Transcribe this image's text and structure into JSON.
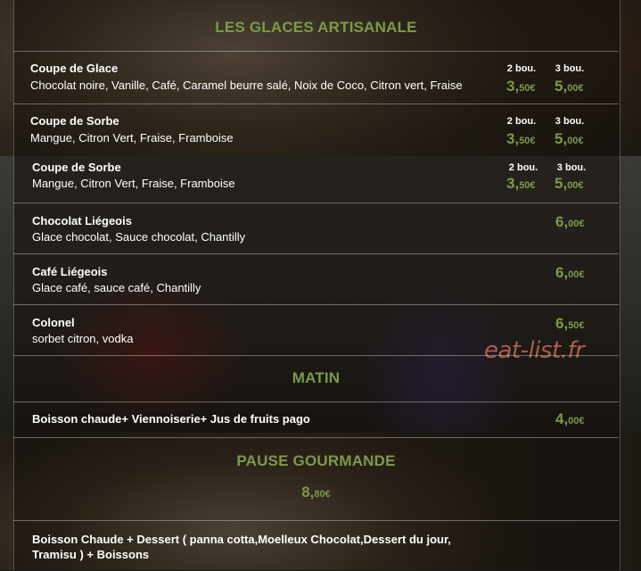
{
  "sections": {
    "glaces_title": "LES GLACES ARTISANALE",
    "matin_title": "MATIN",
    "pause_title": "PAUSE GOURMANDE"
  },
  "size_labels": {
    "two": "2 bou.",
    "three": "3 bou."
  },
  "glaces": [
    {
      "name": "Coupe de Glace",
      "desc": "Chocolat noire, Vanille, Café, Caramel beurre salé, Noix de Coco, Citron vert, Fraise",
      "price2_int": "3,",
      "price2_dec": "50€",
      "price3_int": "5,",
      "price3_dec": "00€"
    },
    {
      "name": "Coupe de Sorbe",
      "desc": "Mangue, Citron Vert, Fraise, Framboise",
      "price2_int": "3,",
      "price2_dec": "50€",
      "price3_int": "5,",
      "price3_dec": "00€"
    }
  ],
  "mid": [
    {
      "name": "Coupe de Sorbe",
      "desc": "Mangue, Citron Vert, Fraise, Framboise",
      "price2_int": "3,",
      "price2_dec": "50€",
      "price3_int": "5,",
      "price3_dec": "00€"
    },
    {
      "name": "Chocolat Liégeois",
      "desc": "Glace chocolat, Sauce chocolat, Chantilly",
      "price_int": "6,",
      "price_dec": "00€"
    },
    {
      "name": "Café Liégeois",
      "desc": "Glace café, sauce café, Chantilly",
      "price_int": "6,",
      "price_dec": "00€"
    },
    {
      "name": "Colonel",
      "desc": "sorbet citron, vodka",
      "price_int": "6,",
      "price_dec": "50€"
    }
  ],
  "matin": {
    "name": "Boisson chaude+ Viennoiserie+ Jus de fruits pago",
    "price_int": "4,",
    "price_dec": "00€"
  },
  "pause": {
    "price_int": "8,",
    "price_dec": "80€",
    "line1": "Boisson Chaude + Dessert ( panna cotta,Moelleux Chocolat,Dessert du jour,",
    "line2": "Tramisu ) + Boissons"
  },
  "watermark": "eat-list.fr",
  "colors": {
    "accent": "#7c9a4a",
    "text": "#ffffff",
    "watermark": "#cd6e55"
  }
}
